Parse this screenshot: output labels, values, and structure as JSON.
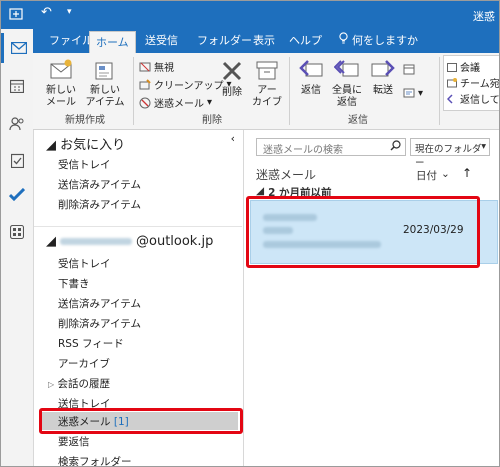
{
  "window": {
    "title": "迷惑"
  },
  "tabs": [
    "ファイル",
    "ホーム",
    "送受信",
    "フォルダー",
    "表示",
    "ヘルプ",
    "何をしますか"
  ],
  "ribbon": {
    "new_mail": "新しい\nメール",
    "new_items": "新しい\nアイテム",
    "group_new": "新規作成",
    "ignore": "無視",
    "cleanup": "クリーンアップ",
    "junk": "迷惑メール",
    "delete": "削除",
    "archive": "アー\nカイブ",
    "group_delete": "削除",
    "reply": "返信",
    "reply_all": "全員に\n返信",
    "forward": "転送",
    "group_respond": "返信",
    "meeting": "会議",
    "team": "チーム宛",
    "reply_more": "返信して"
  },
  "folders": {
    "favorites_header": "お気に入り",
    "favorites": [
      "受信トレイ",
      "送信済みアイテム",
      "削除済みアイテム"
    ],
    "account_suffix": "@outlook.jp",
    "items": [
      "受信トレイ",
      "下書き",
      "送信済みアイテム",
      "削除済みアイテム",
      "RSS フィード",
      "アーカイブ",
      "会話の履歴",
      "送信トレイ",
      "迷惑メール",
      "要返信",
      "検索フォルダー"
    ],
    "junk_count": "[1]"
  },
  "list": {
    "search_placeholder": "迷惑メールの検索",
    "scope": "現在のフォルダー",
    "folder_title": "迷惑メール",
    "sort": "日付",
    "group_header": "2 か月前以前",
    "message_date": "2023/03/29"
  },
  "colors": {
    "accent": "#1e6fbd",
    "highlight": "#e30613",
    "selected": "#cde6f7"
  }
}
